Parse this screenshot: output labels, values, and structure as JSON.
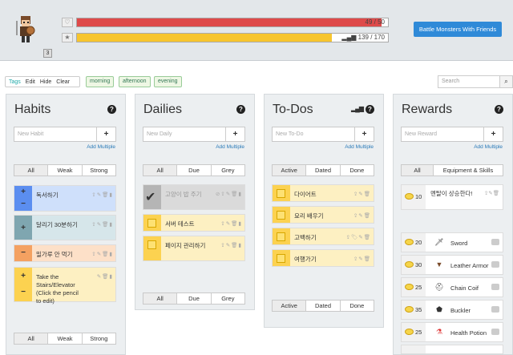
{
  "header": {
    "level": "3",
    "hp": "49 / 50",
    "hp_pct": 98,
    "xp": "139 / 170",
    "xp_pct": 82,
    "battle_label": "Battle Monsters With Friends",
    "heart_icon": "heart-icon",
    "star_icon": "star-icon"
  },
  "filters": {
    "tags": "Tags",
    "edit": "Edit",
    "hide": "Hide",
    "clear": "Clear",
    "afternoon": "afternoon",
    "morning": "morning",
    "evening": "evening",
    "search_placeholder": "Search"
  },
  "add_multiple": "Add Multiple",
  "habits": {
    "title": "Habits",
    "placeholder": "New Habit",
    "tabs": [
      "All",
      "Weak",
      "Strong"
    ],
    "items": [
      "독서하기",
      "달리기 30분하기",
      "밀가루 안 먹기",
      "Take the Stairs/Elevator (Click the pencil to edit)"
    ]
  },
  "dailies": {
    "title": "Dailies",
    "placeholder": "New Daily",
    "tabs": [
      "All",
      "Due",
      "Grey"
    ],
    "items": [
      "고양이 밥 주기",
      "서버 테스트",
      "페이지 관리하기"
    ]
  },
  "todos": {
    "title": "To-Dos",
    "placeholder": "New To-Do",
    "tabs": [
      "Active",
      "Dated",
      "Done"
    ],
    "items": [
      "다이어트",
      "요리 배우기",
      "고백하기",
      "여행가기"
    ]
  },
  "rewards": {
    "title": "Rewards",
    "placeholder": "New Reward",
    "tabs": [
      "All",
      "Equipment & Skills"
    ],
    "custom": {
      "cost": "10",
      "name": "멘탈이 상승한다!"
    },
    "items": [
      {
        "cost": "20",
        "name": "Sword"
      },
      {
        "cost": "30",
        "name": "Leather Armor"
      },
      {
        "cost": "25",
        "name": "Chain Coif"
      },
      {
        "cost": "35",
        "name": "Buckler"
      },
      {
        "cost": "25",
        "name": "Health Potion"
      }
    ]
  }
}
